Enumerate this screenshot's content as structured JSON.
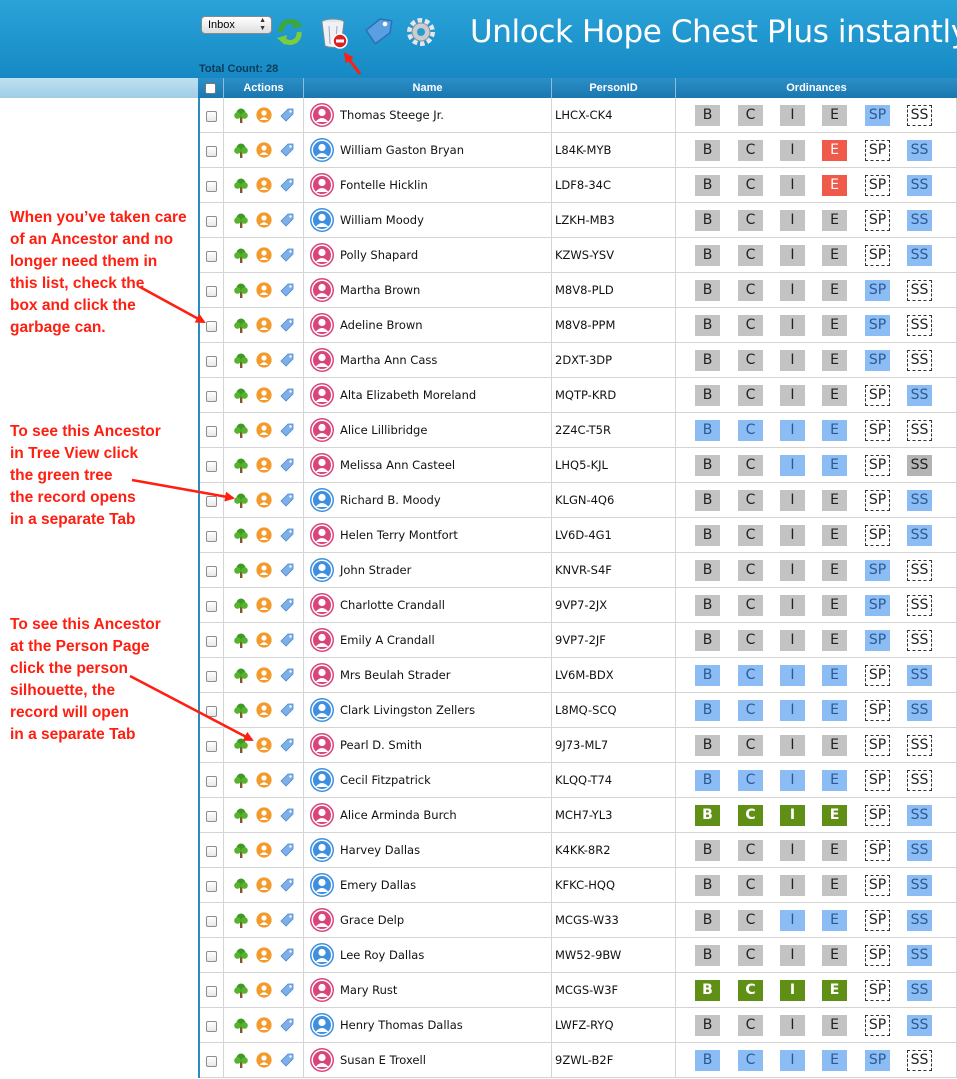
{
  "toolbar": {
    "folder_select": "Inbox",
    "promo": "Unlock Hope Chest Plus instantly"
  },
  "summary": {
    "total_count": "Total Count: 28"
  },
  "table": {
    "headers": {
      "actions": "Actions",
      "name": "Name",
      "person_id": "PersonID",
      "ordinances": "Ordinances"
    },
    "rows": [
      {
        "name": "Thomas Steege Jr.",
        "id": "LHCX-CK4",
        "gender": "female",
        "ord": [
          [
            "B",
            "gray"
          ],
          [
            "C",
            "gray"
          ],
          [
            "I",
            "gray"
          ],
          [
            "E",
            "gray"
          ],
          [
            "SP",
            "blue"
          ],
          [
            "SS",
            "dash"
          ]
        ]
      },
      {
        "name": "William Gaston Bryan",
        "id": "L84K-MYB",
        "gender": "male",
        "ord": [
          [
            "B",
            "gray"
          ],
          [
            "C",
            "gray"
          ],
          [
            "I",
            "gray"
          ],
          [
            "E",
            "red"
          ],
          [
            "SP",
            "dash"
          ],
          [
            "SS",
            "blue"
          ]
        ]
      },
      {
        "name": "Fontelle Hicklin",
        "id": "LDF8-34C",
        "gender": "female",
        "ord": [
          [
            "B",
            "gray"
          ],
          [
            "C",
            "gray"
          ],
          [
            "I",
            "gray"
          ],
          [
            "E",
            "red"
          ],
          [
            "SP",
            "dash"
          ],
          [
            "SS",
            "blue"
          ]
        ]
      },
      {
        "name": "William Moody",
        "id": "LZKH-MB3",
        "gender": "male",
        "ord": [
          [
            "B",
            "gray"
          ],
          [
            "C",
            "gray"
          ],
          [
            "I",
            "gray"
          ],
          [
            "E",
            "gray"
          ],
          [
            "SP",
            "dash"
          ],
          [
            "SS",
            "blue"
          ]
        ]
      },
      {
        "name": "Polly Shapard",
        "id": "KZWS-YSV",
        "gender": "female",
        "ord": [
          [
            "B",
            "gray"
          ],
          [
            "C",
            "gray"
          ],
          [
            "I",
            "gray"
          ],
          [
            "E",
            "gray"
          ],
          [
            "SP",
            "dash"
          ],
          [
            "SS",
            "blue"
          ]
        ]
      },
      {
        "name": "Martha Brown",
        "id": "M8V8-PLD",
        "gender": "female",
        "ord": [
          [
            "B",
            "gray"
          ],
          [
            "C",
            "gray"
          ],
          [
            "I",
            "gray"
          ],
          [
            "E",
            "gray"
          ],
          [
            "SP",
            "blue"
          ],
          [
            "SS",
            "dash"
          ]
        ]
      },
      {
        "name": "Adeline Brown",
        "id": "M8V8-PPM",
        "gender": "female",
        "ord": [
          [
            "B",
            "gray"
          ],
          [
            "C",
            "gray"
          ],
          [
            "I",
            "gray"
          ],
          [
            "E",
            "gray"
          ],
          [
            "SP",
            "blue"
          ],
          [
            "SS",
            "dash"
          ]
        ]
      },
      {
        "name": "Martha Ann Cass",
        "id": "2DXT-3DP",
        "gender": "female",
        "ord": [
          [
            "B",
            "gray"
          ],
          [
            "C",
            "gray"
          ],
          [
            "I",
            "gray"
          ],
          [
            "E",
            "gray"
          ],
          [
            "SP",
            "blue"
          ],
          [
            "SS",
            "dash"
          ]
        ]
      },
      {
        "name": "Alta Elizabeth Moreland",
        "id": "MQTP-KRD",
        "gender": "female",
        "ord": [
          [
            "B",
            "gray"
          ],
          [
            "C",
            "gray"
          ],
          [
            "I",
            "gray"
          ],
          [
            "E",
            "gray"
          ],
          [
            "SP",
            "dash"
          ],
          [
            "SS",
            "blue"
          ]
        ]
      },
      {
        "name": "Alice Lillibridge",
        "id": "2Z4C-T5R",
        "gender": "female",
        "ord": [
          [
            "B",
            "blue"
          ],
          [
            "C",
            "blue"
          ],
          [
            "I",
            "blue"
          ],
          [
            "E",
            "blue"
          ],
          [
            "SP",
            "dash"
          ],
          [
            "SS",
            "dash"
          ]
        ]
      },
      {
        "name": "Melissa Ann Casteel",
        "id": "LHQ5-KJL",
        "gender": "female",
        "ord": [
          [
            "B",
            "gray"
          ],
          [
            "C",
            "gray"
          ],
          [
            "I",
            "blue"
          ],
          [
            "E",
            "blue"
          ],
          [
            "SP",
            "dash"
          ],
          [
            "SS",
            "darkgray"
          ]
        ]
      },
      {
        "name": "Richard B. Moody",
        "id": "KLGN-4Q6",
        "gender": "male",
        "ord": [
          [
            "B",
            "gray"
          ],
          [
            "C",
            "gray"
          ],
          [
            "I",
            "gray"
          ],
          [
            "E",
            "gray"
          ],
          [
            "SP",
            "dash"
          ],
          [
            "SS",
            "blue"
          ]
        ]
      },
      {
        "name": "Helen Terry Montfort",
        "id": "LV6D-4G1",
        "gender": "female",
        "ord": [
          [
            "B",
            "gray"
          ],
          [
            "C",
            "gray"
          ],
          [
            "I",
            "gray"
          ],
          [
            "E",
            "gray"
          ],
          [
            "SP",
            "dash"
          ],
          [
            "SS",
            "blue"
          ]
        ]
      },
      {
        "name": "John Strader",
        "id": "KNVR-S4F",
        "gender": "male",
        "ord": [
          [
            "B",
            "gray"
          ],
          [
            "C",
            "gray"
          ],
          [
            "I",
            "gray"
          ],
          [
            "E",
            "gray"
          ],
          [
            "SP",
            "blue"
          ],
          [
            "SS",
            "dash"
          ]
        ]
      },
      {
        "name": "Charlotte Crandall",
        "id": "9VP7-2JX",
        "gender": "female",
        "ord": [
          [
            "B",
            "gray"
          ],
          [
            "C",
            "gray"
          ],
          [
            "I",
            "gray"
          ],
          [
            "E",
            "gray"
          ],
          [
            "SP",
            "blue"
          ],
          [
            "SS",
            "dash"
          ]
        ]
      },
      {
        "name": "Emily A Crandall",
        "id": "9VP7-2JF",
        "gender": "female",
        "ord": [
          [
            "B",
            "gray"
          ],
          [
            "C",
            "gray"
          ],
          [
            "I",
            "gray"
          ],
          [
            "E",
            "gray"
          ],
          [
            "SP",
            "blue"
          ],
          [
            "SS",
            "dash"
          ]
        ]
      },
      {
        "name": "Mrs Beulah Strader",
        "id": "LV6M-BDX",
        "gender": "female",
        "ord": [
          [
            "B",
            "blue"
          ],
          [
            "C",
            "blue"
          ],
          [
            "I",
            "blue"
          ],
          [
            "E",
            "blue"
          ],
          [
            "SP",
            "dash"
          ],
          [
            "SS",
            "blue"
          ]
        ]
      },
      {
        "name": "Clark Livingston Zellers",
        "id": "L8MQ-SCQ",
        "gender": "male",
        "ord": [
          [
            "B",
            "blue"
          ],
          [
            "C",
            "blue"
          ],
          [
            "I",
            "blue"
          ],
          [
            "E",
            "blue"
          ],
          [
            "SP",
            "dash"
          ],
          [
            "SS",
            "blue"
          ]
        ]
      },
      {
        "name": "Pearl D. Smith",
        "id": "9J73-ML7",
        "gender": "female",
        "ord": [
          [
            "B",
            "gray"
          ],
          [
            "C",
            "gray"
          ],
          [
            "I",
            "gray"
          ],
          [
            "E",
            "gray"
          ],
          [
            "SP",
            "dash"
          ],
          [
            "SS",
            "dash"
          ]
        ]
      },
      {
        "name": "Cecil Fitzpatrick",
        "id": "KLQQ-T74",
        "gender": "male",
        "ord": [
          [
            "B",
            "blue"
          ],
          [
            "C",
            "blue"
          ],
          [
            "I",
            "blue"
          ],
          [
            "E",
            "blue"
          ],
          [
            "SP",
            "dash"
          ],
          [
            "SS",
            "dash"
          ]
        ]
      },
      {
        "name": "Alice Arminda Burch",
        "id": "MCH7-YL3",
        "gender": "female",
        "ord": [
          [
            "B",
            "green"
          ],
          [
            "C",
            "green"
          ],
          [
            "I",
            "green"
          ],
          [
            "E",
            "green"
          ],
          [
            "SP",
            "dash"
          ],
          [
            "SS",
            "blue"
          ]
        ]
      },
      {
        "name": "Harvey Dallas",
        "id": "K4KK-8R2",
        "gender": "male",
        "ord": [
          [
            "B",
            "gray"
          ],
          [
            "C",
            "gray"
          ],
          [
            "I",
            "gray"
          ],
          [
            "E",
            "gray"
          ],
          [
            "SP",
            "dash"
          ],
          [
            "SS",
            "blue"
          ]
        ]
      },
      {
        "name": "Emery Dallas",
        "id": "KFKC-HQQ",
        "gender": "male",
        "ord": [
          [
            "B",
            "gray"
          ],
          [
            "C",
            "gray"
          ],
          [
            "I",
            "gray"
          ],
          [
            "E",
            "gray"
          ],
          [
            "SP",
            "dash"
          ],
          [
            "SS",
            "blue"
          ]
        ]
      },
      {
        "name": "Grace Delp",
        "id": "MCGS-W33",
        "gender": "female",
        "ord": [
          [
            "B",
            "gray"
          ],
          [
            "C",
            "gray"
          ],
          [
            "I",
            "blue"
          ],
          [
            "E",
            "blue"
          ],
          [
            "SP",
            "dash"
          ],
          [
            "SS",
            "blue"
          ]
        ]
      },
      {
        "name": "Lee Roy Dallas",
        "id": "MW52-9BW",
        "gender": "male",
        "ord": [
          [
            "B",
            "gray"
          ],
          [
            "C",
            "gray"
          ],
          [
            "I",
            "gray"
          ],
          [
            "E",
            "gray"
          ],
          [
            "SP",
            "dash"
          ],
          [
            "SS",
            "blue"
          ]
        ]
      },
      {
        "name": "Mary Rust",
        "id": "MCGS-W3F",
        "gender": "female",
        "ord": [
          [
            "B",
            "green"
          ],
          [
            "C",
            "green"
          ],
          [
            "I",
            "green"
          ],
          [
            "E",
            "green"
          ],
          [
            "SP",
            "dash"
          ],
          [
            "SS",
            "blue"
          ]
        ]
      },
      {
        "name": "Henry Thomas Dallas",
        "id": "LWFZ-RYQ",
        "gender": "male",
        "ord": [
          [
            "B",
            "gray"
          ],
          [
            "C",
            "gray"
          ],
          [
            "I",
            "gray"
          ],
          [
            "E",
            "gray"
          ],
          [
            "SP",
            "dash"
          ],
          [
            "SS",
            "blue"
          ]
        ]
      },
      {
        "name": "Susan E Troxell",
        "id": "9ZWL-B2F",
        "gender": "female",
        "ord": [
          [
            "B",
            "blue"
          ],
          [
            "C",
            "blue"
          ],
          [
            "I",
            "blue"
          ],
          [
            "E",
            "blue"
          ],
          [
            "SP",
            "blue"
          ],
          [
            "SS",
            "dash"
          ]
        ]
      }
    ]
  },
  "annotations": {
    "note_1": [
      "When you’ve taken care",
      "of an Ancestor and no",
      "longer need them in",
      "this list, check the",
      "box and click the",
      "garbage can."
    ],
    "note_2": [
      "To see this Ancestor",
      "in Tree View click",
      "the green tree",
      "the record opens",
      "in a separate Tab"
    ],
    "note_3": [
      "To see this Ancestor",
      "at the Person Page",
      "click the person",
      "silhouette, the",
      "record will open",
      "in a separate Tab"
    ]
  },
  "colors": {
    "header_blue": "#1689c4",
    "annotation_red": "#ff1e10",
    "ordinance_gray": "#c3c3c3",
    "ordinance_blue": "#8cbcf4",
    "ordinance_red": "#ef5a4a",
    "ordinance_green": "#5f8f14"
  },
  "icons": [
    "refresh-icon",
    "trash-icon",
    "tag-icon",
    "gear-icon",
    "tree-icon",
    "person-icon",
    "tag-icon"
  ]
}
